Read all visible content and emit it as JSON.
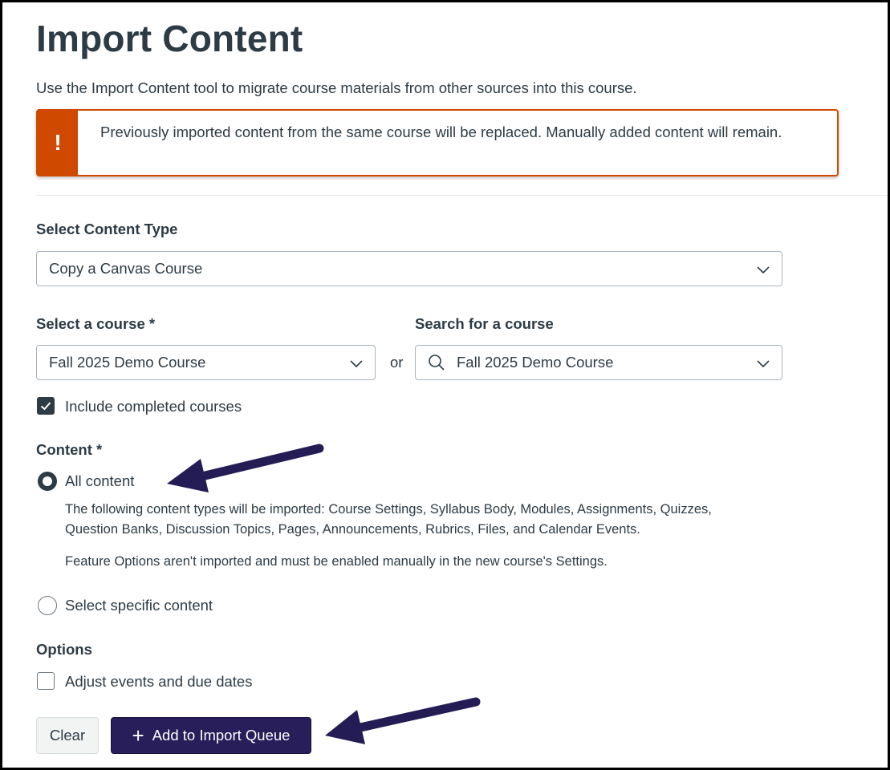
{
  "page": {
    "title": "Import Content",
    "intro": "Use the Import Content tool to migrate course materials from other sources into this course."
  },
  "alert": {
    "icon": "!",
    "text": "Previously imported content from the same course will be replaced. Manually added content will remain.",
    "color": "#cf4a00"
  },
  "content_type": {
    "label": "Select Content Type",
    "value": "Copy a Canvas Course"
  },
  "course_select": {
    "label": "Select a course *",
    "value": "Fall 2025 Demo Course"
  },
  "or_text": "or",
  "course_search": {
    "label": "Search for a course",
    "value": "Fall 2025 Demo Course"
  },
  "include_completed": {
    "label": "Include completed courses",
    "checked": true
  },
  "content": {
    "label": "Content *",
    "all": {
      "label": "All content",
      "selected": true,
      "description_1": "The following content types will be imported: Course Settings, Syllabus Body, Modules, Assignments, Quizzes, Question Banks, Discussion Topics, Pages, Announcements, Rubrics, Files, and Calendar Events.",
      "description_2": "Feature Options aren't imported and must be enabled manually in the new course's Settings."
    },
    "specific": {
      "label": "Select specific content",
      "selected": false
    }
  },
  "options": {
    "label": "Options",
    "adjust_dates": {
      "label": "Adjust events and due dates",
      "checked": false
    }
  },
  "buttons": {
    "clear": "Clear",
    "add": "Add to Import Queue",
    "add_icon": "plus-icon",
    "add_color": "#271e5a"
  },
  "annotations": {
    "arrow_color": "#241c55"
  }
}
